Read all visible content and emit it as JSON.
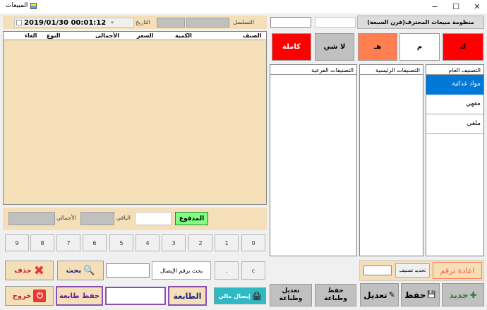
{
  "window": {
    "title": "المبيعات",
    "minimize": "−",
    "maximize": "☐",
    "close": "✕"
  },
  "header": {
    "time_date": "2019/01/30 00:01:12",
    "date_label": "التاريخ",
    "serial_label": "التسلسل",
    "app_title": "منظومة مبيعات المحترف(فرن السبعة)"
  },
  "grid": {
    "columns": [
      "الصنف",
      "الكمية",
      "السعر",
      "الأجمالى",
      "النوع",
      "الغاء"
    ]
  },
  "totals": {
    "paid_label": "المدفوع",
    "remaining_label": "الباقي",
    "total_label": "الأجمالي"
  },
  "keypad": {
    "keys": [
      "0",
      "1",
      "2",
      "3",
      "4",
      "5",
      "6",
      "7",
      "8",
      "9"
    ],
    "dot": ".",
    "clear": "c"
  },
  "actions": {
    "delete": "حذف",
    "search": "بحث",
    "search_receipt": "بحث برقم الإيصال",
    "exit": "خروج",
    "save_print": "حفظ طابعة",
    "printer": "الطابعة",
    "financial_receipt": "إيصال مالي"
  },
  "order_types": {
    "full": "كاملة",
    "nothing": "لا شي",
    "h": "هـ",
    "m": "م",
    "k": "ك"
  },
  "categories": {
    "main_col": "التصنيف العام",
    "sub_main": "التصنيفات الرئيسية",
    "sub_sub": "التصنيفات الفرعية",
    "main_items": [
      "مواد غذائية",
      "مقهي",
      "ملغي"
    ]
  },
  "bottom": {
    "renumber": "اعادة ترقم",
    "edit_category": "تحديد تصنيف",
    "new": "جديد",
    "save": "حفظ",
    "edit": "تعديل",
    "save_and_print": "حفظ وطباعة",
    "edit_and_print": "تعديل وطباعة"
  },
  "colors": {
    "panel": "#f5dfb9",
    "red": "#ff0000",
    "orange": "#ff7f50",
    "grey": "#c0c0c0",
    "selected_blue": "#0078d7",
    "purple": "#8a4fb3",
    "teal": "#2fb9c4"
  }
}
